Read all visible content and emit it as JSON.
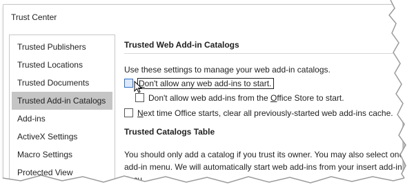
{
  "window": {
    "title": "Trust Center"
  },
  "sidebar": {
    "items": [
      {
        "label": "Trusted Publishers",
        "selected": false
      },
      {
        "label": "Trusted Locations",
        "selected": false
      },
      {
        "label": "Trusted Documents",
        "selected": false
      },
      {
        "label": "Trusted Add-in Catalogs",
        "selected": true
      },
      {
        "label": "Add-ins",
        "selected": false
      },
      {
        "label": "ActiveX Settings",
        "selected": false
      },
      {
        "label": "Macro Settings",
        "selected": false
      },
      {
        "label": "Protected View",
        "selected": false
      }
    ]
  },
  "main": {
    "section1_title": "Trusted Web Add-in Catalogs",
    "description": "Use these settings to manage your web add-in catalogs.",
    "opt1": {
      "mnemonic": "D",
      "rest": "on't allow any web add-ins to start.",
      "checked": false
    },
    "opt2": {
      "before": "Don't allow web add-ins from the ",
      "mnemonic": "O",
      "after": "ffice Store to start.",
      "checked": false
    },
    "opt3": {
      "mnemonic": "N",
      "rest": "ext time Office starts, clear all previously-started web add-ins cache.",
      "checked": false
    },
    "section2_title": "Trusted Catalogs Table",
    "para_line1": "You should only add a catalog if you trust its owner. You may also select one of e",
    "para_line2": "add-in menu. We will automatically start web add-ins from your insert add-in m",
    "para_line3": "docu"
  },
  "colors": {
    "selected_bg": "#c5c5c5",
    "border": "#c6c6c6",
    "hover_cb": "#2b6fc8"
  }
}
